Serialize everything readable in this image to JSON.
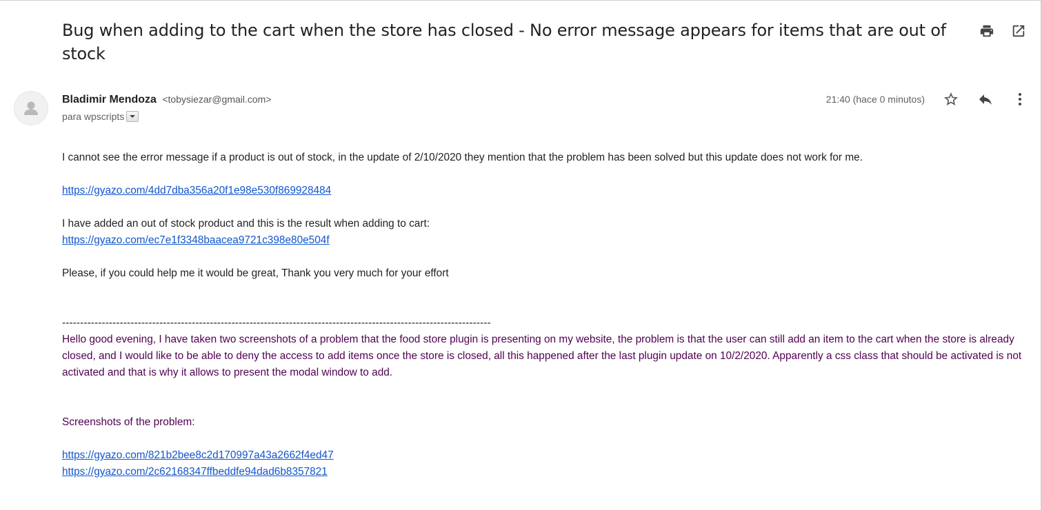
{
  "email": {
    "subject": "Bug when adding to the cart when the store has closed - No error message appears for items that are out of stock",
    "sender_name": "Bladimir Mendoza",
    "sender_email": "<tobysiezar@gmail.com>",
    "recipient": "para wpscripts",
    "timestamp": "21:40 (hace 0 minutos)",
    "body": {
      "p1": "I cannot see the error message if a product is out of stock, in the update of 2/10/2020 they mention that the problem has been solved but this update does not work for me.",
      "link1": "https://gyazo.com/4dd7dba356a20f1e98e530f869928484",
      "p2": "I have added an out of stock product and this is the result when adding to cart:",
      "link2": "https://gyazo.com/ec7e1f3348baacea9721c398e80e504f",
      "p3": "Please, if you could help me it would be great, Thank you very much for your effort",
      "separator": "-----------------------------------------------------------------------------------------------------------------------",
      "quoted_p1": "Hello good evening, I have taken two screenshots of a problem that the food store plugin is presenting on my website, the problem is that the user can still add an item to the cart when the store is already closed, and I would like to be able to deny the access to add items once the store is closed, all this happened after the last plugin update on 10/2/2020. Apparently a css class that should be activated is not activated and that is why it allows to present the modal window to add.",
      "quoted_p2": "Screenshots of the problem:",
      "quoted_link1": "https://gyazo.com/821b2bee8c2d170997a43a2662f4ed47",
      "quoted_link2": "https://gyazo.com/2c62168347ffbeddfe94dad6b8357821"
    }
  },
  "icons": {
    "print": "print-icon",
    "open_new_window": "open-in-new-window-icon",
    "avatar": "default-avatar-icon",
    "dropdown": "triangle-down-icon",
    "star": "star-icon",
    "reply": "reply-icon",
    "more": "more-vertical-icon"
  },
  "colors": {
    "text": "#222222",
    "link": "#1155cc",
    "quoted_text": "#500050",
    "secondary_text": "#5f5f5f"
  }
}
